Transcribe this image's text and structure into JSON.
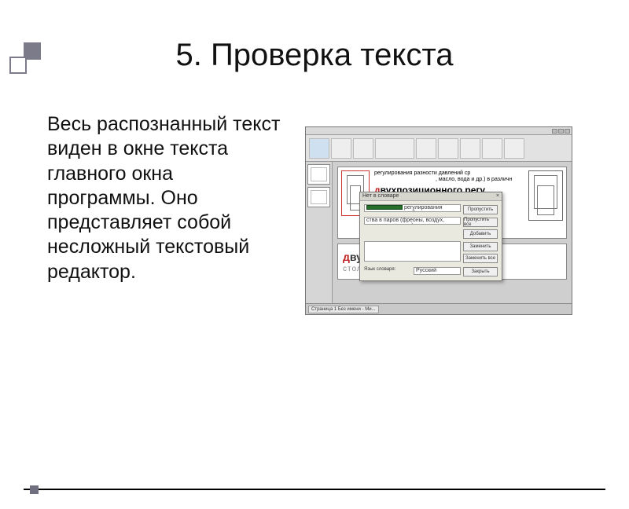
{
  "slide": {
    "title": "5. Проверка текста",
    "body": "Весь распознанный текст виден в окне текста главного окна программы. Оно представляет собой несложный текстовый редактор."
  },
  "screenshot": {
    "dialog_title": "Нет в словаре",
    "dialog_close": "×",
    "dialog_line1": "регулирования разности давлений сред",
    "dialog_line2": "ства в паров (фреоны, воздух, масло, вода и др.) в различн",
    "dialog_lang_label": "Язык словаря:",
    "dialog_lang_value": "Русский",
    "dialog_buttons": {
      "skip": "Пропустить",
      "skip_all": "Пропустить все",
      "add": "Добавить",
      "replace": "Заменить",
      "replace_all": "Заменить все",
      "cancel": "Закрыть"
    },
    "doc_small_text": "регулирования разности давлений ср",
    "doc_small_text2": ", масло, вода и др.) в различн",
    "highlight_top_prefix": "д",
    "highlight_top_rest": "вухпозиционного  регу",
    "highlight_bottom_prefix": "д",
    "highlight_bottom_rest": "вухпозиционного  регули",
    "faint_line": "стола  и  патали  (фронты   по",
    "status_label": "Страница 1 Без имени - Ми..."
  }
}
